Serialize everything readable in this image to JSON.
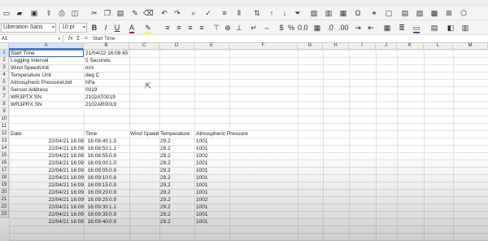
{
  "toolbar": {
    "font_name": "Liberation Sans",
    "font_size": "10 pt",
    "bold": "B",
    "italic": "I",
    "underline": "U"
  },
  "formula_bar": {
    "cell_ref": "A1",
    "fx": "fx",
    "sum": "Σ",
    "equals": "=",
    "content": "Start Time"
  },
  "columns": [
    "A",
    "B",
    "C",
    "D",
    "E",
    "F",
    "G",
    "H",
    "I",
    "J",
    "K",
    "L",
    "M"
  ],
  "rows": [
    "1",
    "2",
    "3",
    "4",
    "5",
    "6",
    "7",
    "8",
    "9",
    "10",
    "11",
    "12",
    "13",
    "14",
    "15",
    "16",
    "17",
    "18",
    "19",
    "20",
    "21",
    "22",
    "23"
  ],
  "header_info": [
    {
      "label": "Start Time",
      "value": "21/04/22 16:08:45"
    },
    {
      "label": "Logging Interval",
      "value": "5 Seconds"
    },
    {
      "label": "Wind SpeedUnit",
      "value": "m/s"
    },
    {
      "label": "Temperature Unit",
      "value": "deg C"
    },
    {
      "label": "Atmospheric PressureUnit",
      "value": "hPa"
    },
    {
      "label": "Sensor Address",
      "value": "0019"
    },
    {
      "label": "WR3PTX SN",
      "value": "2102AT0019"
    },
    {
      "label": "WR3PRX SN",
      "value": "2102AR0019"
    }
  ],
  "table_headers": [
    "Date",
    "Time",
    "Wind Speed",
    "Temperature",
    "Atmospheric Pressure"
  ],
  "table_rows": [
    [
      "22/04/21 16:08",
      "16:08:45",
      "1.3",
      "29.2",
      "1001"
    ],
    [
      "22/04/21 16:08",
      "16:08:50",
      "1.1",
      "29.2",
      "1001"
    ],
    [
      "22/04/21 16:08",
      "16:08:55",
      "0.9",
      "29.2",
      "1002"
    ],
    [
      "22/04/21 16:09",
      "16:09:00",
      "1.0",
      "29.2",
      "1001"
    ],
    [
      "22/04/21 16:09",
      "16:09:05",
      "0.9",
      "29.2",
      "1001"
    ],
    [
      "22/04/21 16:09",
      "16:09:10",
      "0.8",
      "29.2",
      "1001"
    ],
    [
      "22/04/21 16:09",
      "16:09:15",
      "0.9",
      "29.2",
      "1001"
    ],
    [
      "22/04/21 16:09",
      "16:09:20",
      "0.9",
      "29.2",
      "1001"
    ],
    [
      "22/04/21 16:09",
      "16:09:25",
      "0.9",
      "29.2",
      "1002"
    ],
    [
      "22/04/21 16:09",
      "16:09:30",
      "1.1",
      "29.2",
      "1001"
    ],
    [
      "22/04/21 16:09",
      "16:09:35",
      "0.9",
      "29.2",
      "1001"
    ],
    [
      "22/04/21 16:09",
      "16:09:40",
      "0.9",
      "29.2",
      "1001"
    ]
  ]
}
